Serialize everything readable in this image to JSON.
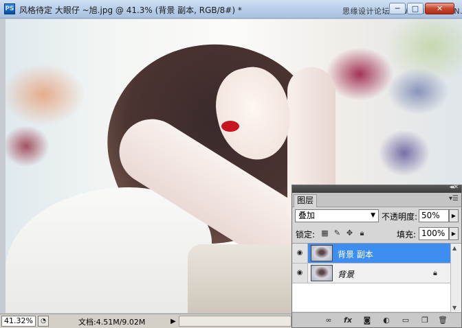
{
  "window": {
    "app_icon": "PS",
    "title": "风格待定 大眼仔 ~旭.jpg @ 41.3% (背景 副本, RGB/8#) *",
    "watermark": "思缘设计论坛 WWW.MISSYUAN.COM",
    "min_icon": "minimize-icon",
    "max_icon": "maximize-icon",
    "close_icon": "close-icon"
  },
  "statusbar": {
    "zoom": "41.32%",
    "doc_info": "文档:4.51M/9.02M"
  },
  "layers_panel": {
    "tab": "图层",
    "blend_mode": "叠加",
    "opacity_label": "不透明度:",
    "opacity": "50%",
    "lock_label": "锁定:",
    "fill_label": "填充:",
    "fill": "100%",
    "layers": [
      {
        "name": "背景 副本",
        "selected": true,
        "visible": true,
        "locked": false
      },
      {
        "name": "背景",
        "selected": false,
        "visible": true,
        "locked": true
      }
    ],
    "footer_icons": [
      "link-icon",
      "fx-icon",
      "mask-icon",
      "adjustment-icon",
      "group-folder-icon",
      "new-layer-icon",
      "trash-icon"
    ]
  },
  "colors": {
    "selection": "#3d8ef0",
    "panel_bg": "#d6d6d6",
    "title_bar": "#b7cde8"
  }
}
